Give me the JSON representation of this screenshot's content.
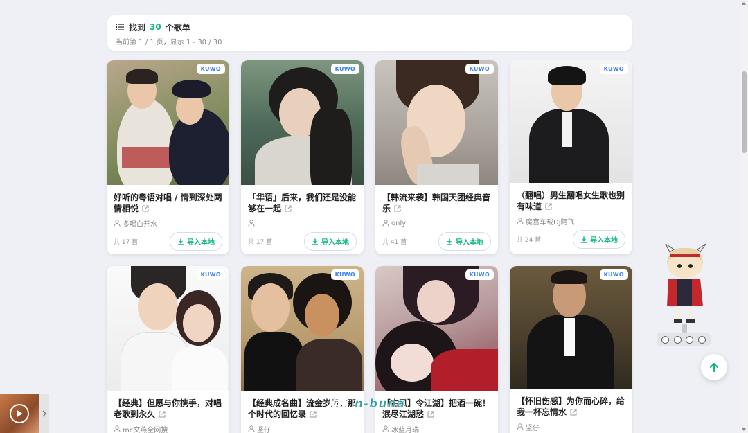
{
  "summary": {
    "prefix": "找到",
    "count": "30",
    "suffix": "个歌单",
    "pagination": "当前第 1 / 1 页，显示 1 - 30 / 30"
  },
  "source_badge": "KUWO",
  "import_label": "导入本地",
  "playlists": [
    {
      "title": "好听的粤语对唱 / 情到深处两情相悦",
      "author": "多喝白开水",
      "songs": "共 17 首"
    },
    {
      "title": "「华语」后来，我们还是没能够在一起",
      "author": "",
      "songs": "共 17 首"
    },
    {
      "title": "【韩流来袭】韩国天团经典音乐",
      "author": "only",
      "songs": "共 41 首"
    },
    {
      "title": "（翻唱）男生翻唱女生歌也别有味道",
      "author": "魔宫车载DJ阿飞",
      "songs": "共 24 首"
    },
    {
      "title": "【经典】但愿与你携手，对唱老歌到永久",
      "author": "mc文燕全网搜",
      "songs": ""
    },
    {
      "title": "【经典成名曲】流金岁月：那个时代的回忆录",
      "author": "坚仔",
      "songs": ""
    },
    {
      "title": "【古风】令江湖】把酒一碗！泯尽江湖愁",
      "author": "冰蓝月瑞",
      "songs": ""
    },
    {
      "title": "【怀旧伤感】为你而心碎，给我一杯忘情水",
      "author": "坚仔",
      "songs": ""
    }
  ],
  "lyric": "词：n-buna",
  "colors": {
    "accent": "#10b981",
    "badge": "#3b82f6",
    "background": "#eef0f5"
  }
}
